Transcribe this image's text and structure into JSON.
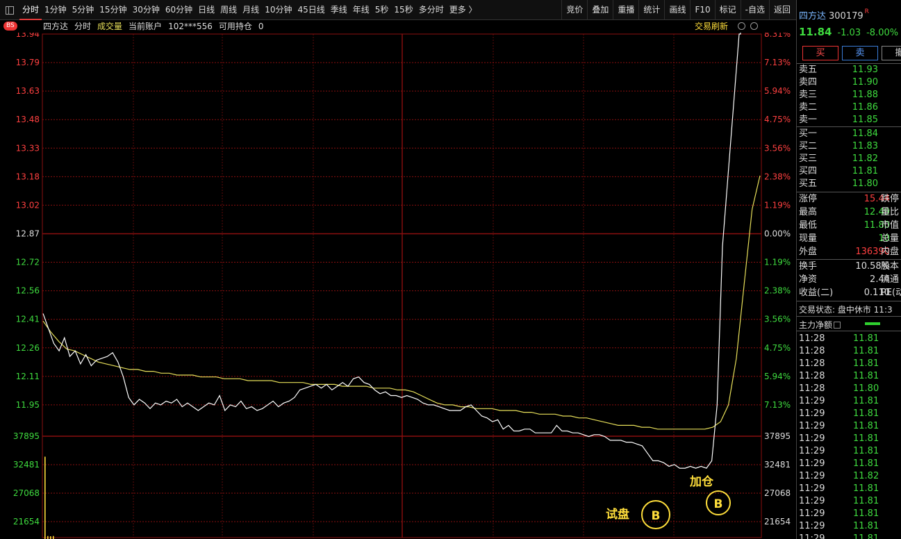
{
  "toolbar": {
    "period_tabs": [
      "分时",
      "1分钟",
      "5分钟",
      "15分钟",
      "30分钟",
      "60分钟",
      "日线",
      "周线",
      "月线",
      "10分钟",
      "45日线",
      "季线",
      "年线",
      "5秒",
      "15秒",
      "多分时",
      "更多 〉"
    ],
    "active_tab": "分时",
    "right_buttons": [
      "竞价",
      "叠加",
      "重播",
      "统计",
      "画线",
      "F10",
      "标记",
      "-自选",
      "返回"
    ]
  },
  "info_bar": {
    "badge": "BS",
    "stock_name": "四方达",
    "mode": "分时",
    "volume_label": "成交量",
    "account_label": "当前账户",
    "account_no": "102***556",
    "position_label": "可用持仓",
    "position_value": "0",
    "refresh_label": "交易刷新"
  },
  "colors": {
    "price_line": "#ffffff",
    "avg_line": "#e8e05a",
    "grid_red": "#8b0f0f",
    "up_red": "#ff4040",
    "down_green": "#3fdc3f",
    "marker_yellow": "#ffde3b"
  },
  "chart_data": {
    "type": "line",
    "y_ticks_left": [
      "13.94",
      "13.79",
      "13.63",
      "13.48",
      "13.33",
      "13.18",
      "13.02",
      "12.87",
      "12.72",
      "12.56",
      "12.41",
      "12.26",
      "12.11",
      "11.95"
    ],
    "y_ticks_right": [
      "8.31%",
      "7.13%",
      "5.94%",
      "4.75%",
      "3.56%",
      "2.38%",
      "1.19%",
      "0.00%",
      "1.19%",
      "2.38%",
      "3.56%",
      "4.75%",
      "5.94%",
      "7.13%"
    ],
    "volume_ticks_left": [
      "37895",
      "32481",
      "27068",
      "21654"
    ],
    "volume_ticks_right": [
      "37895",
      "32481",
      "27068",
      "21654"
    ],
    "ylim": [
      11.95,
      13.94
    ],
    "prev_close": 12.87,
    "series": [
      {
        "values": [
          12.44,
          12.36,
          12.28,
          12.24,
          12.31,
          12.21,
          12.24,
          12.17,
          12.22,
          12.16,
          12.19,
          12.2,
          12.21,
          12.23,
          12.18,
          12.1,
          11.99,
          11.95,
          11.98,
          11.96,
          11.93,
          11.96,
          11.95,
          11.97,
          11.96,
          11.98,
          11.94,
          11.96,
          11.94,
          11.92,
          11.94,
          11.96,
          11.95,
          12.0,
          11.92,
          11.95,
          11.94,
          11.97,
          11.93,
          11.94,
          11.92,
          11.93,
          11.95,
          11.97,
          11.94,
          11.96,
          11.97,
          11.99,
          12.03,
          12.04,
          12.05,
          12.06,
          12.04,
          12.06,
          12.03,
          12.05,
          12.07,
          12.05,
          12.09,
          12.1,
          12.07,
          12.06,
          12.03,
          12.01,
          12.02,
          12.0,
          12.0,
          11.99,
          12.0,
          11.99,
          11.98,
          11.96,
          11.95,
          11.95,
          11.94,
          11.93,
          11.92,
          11.92,
          11.92,
          11.94,
          11.95,
          11.92,
          11.89,
          11.88,
          11.86,
          11.87,
          11.82,
          11.84,
          11.81,
          11.81,
          11.82,
          11.82,
          11.8,
          11.8,
          11.8,
          11.8,
          11.84,
          11.81,
          11.81,
          11.8,
          11.8,
          11.79,
          11.78,
          11.79,
          11.79,
          11.78,
          11.76,
          11.76,
          11.76,
          11.75,
          11.75,
          11.74,
          11.73,
          11.69,
          11.65,
          11.65,
          11.64,
          11.62,
          11.63,
          11.61,
          11.61,
          11.62,
          11.61,
          11.62,
          11.61,
          11.65,
          11.95,
          12.8,
          13.94,
          13.94
        ]
      },
      {
        "values": [
          12.4,
          12.34,
          12.29,
          12.25,
          12.24,
          12.22,
          12.2,
          12.18,
          12.17,
          12.16,
          12.15,
          12.14,
          12.14,
          12.13,
          12.13,
          12.12,
          12.12,
          12.11,
          12.11,
          12.11,
          12.1,
          12.1,
          12.1,
          12.09,
          12.09,
          12.09,
          12.08,
          12.08,
          12.08,
          12.08,
          12.07,
          12.07,
          12.07,
          12.07,
          12.06,
          12.06,
          12.06,
          12.06,
          12.05,
          12.05,
          12.05,
          12.05,
          12.04,
          12.04,
          12.04,
          12.03,
          12.03,
          12.02,
          12.0,
          11.98,
          11.96,
          11.95,
          11.95,
          11.94,
          11.94,
          11.93,
          11.93,
          11.93,
          11.92,
          11.92,
          11.92,
          11.91,
          11.91,
          11.9,
          11.9,
          11.9,
          11.89,
          11.89,
          11.88,
          11.88,
          11.87,
          11.86,
          11.85,
          11.84,
          11.84,
          11.84,
          11.83,
          11.83,
          11.82,
          11.82,
          11.82,
          11.82,
          11.82,
          11.82,
          11.82,
          11.83,
          11.86,
          11.95,
          12.2,
          12.6,
          13.0,
          13.18
        ]
      }
    ],
    "volume_bars": [
      34000,
      2000,
      1500,
      2000
    ]
  },
  "annotations": {
    "buy1_label": "试盘",
    "buy1_marker": "B",
    "buy2_label": "加仓",
    "buy2_marker": "B"
  },
  "panel": {
    "name": "四方达",
    "code": "300179",
    "badge": "R",
    "price": "11.84",
    "change": "-1.03",
    "change_pct": "-8.00%",
    "buy_button": "买",
    "sell_button": "卖",
    "cancel_button": "撤",
    "asks": [
      {
        "label": "卖五",
        "price": "11.93"
      },
      {
        "label": "卖四",
        "price": "11.90"
      },
      {
        "label": "卖三",
        "price": "11.88"
      },
      {
        "label": "卖二",
        "price": "11.86"
      },
      {
        "label": "卖一",
        "price": "11.85"
      }
    ],
    "bids": [
      {
        "label": "买一",
        "price": "11.84"
      },
      {
        "label": "买二",
        "price": "11.83"
      },
      {
        "label": "买三",
        "price": "11.82"
      },
      {
        "label": "买四",
        "price": "11.81"
      },
      {
        "label": "买五",
        "price": "11.80"
      }
    ],
    "stats1": [
      {
        "label": "涨停",
        "value": "15.44",
        "label2": "跌停",
        "color": "#ff4040"
      },
      {
        "label": "最高",
        "value": "12.49",
        "label2": "量比",
        "color": "#3fdc3f"
      },
      {
        "label": "最低",
        "value": "11.80",
        "label2": "市值",
        "color": "#3fdc3f"
      },
      {
        "label": "现量",
        "value": "10",
        "label2": "总量",
        "color": "#3fdc3f"
      },
      {
        "label": "外盘",
        "value": "136390",
        "label2": "内盘",
        "color": "#ff4040"
      }
    ],
    "stats2": [
      {
        "label": "换手",
        "value": "10.58%",
        "label2": "股本",
        "color": "#dddddd"
      },
      {
        "label": "净资",
        "value": "2.44",
        "label2": "流通",
        "color": "#dddddd"
      },
      {
        "label": "收益(二)",
        "value": "0.110",
        "label2": "PE(动",
        "color": "#dddddd"
      }
    ],
    "trade_status": "交易状态: 盘中休市 11:3",
    "main_flow_label": "主力净额",
    "ticks": [
      {
        "time": "11:28",
        "price": "11.81"
      },
      {
        "time": "11:28",
        "price": "11.81"
      },
      {
        "time": "11:28",
        "price": "11.81"
      },
      {
        "time": "11:28",
        "price": "11.81"
      },
      {
        "time": "11:28",
        "price": "11.80"
      },
      {
        "time": "11:29",
        "price": "11.81"
      },
      {
        "time": "11:29",
        "price": "11.81"
      },
      {
        "time": "11:29",
        "price": "11.81"
      },
      {
        "time": "11:29",
        "price": "11.81"
      },
      {
        "time": "11:29",
        "price": "11.81"
      },
      {
        "time": "11:29",
        "price": "11.81"
      },
      {
        "time": "11:29",
        "price": "11.82"
      },
      {
        "time": "11:29",
        "price": "11.81"
      },
      {
        "time": "11:29",
        "price": "11.81"
      },
      {
        "time": "11:29",
        "price": "11.81"
      },
      {
        "time": "11:29",
        "price": "11.81"
      },
      {
        "time": "11:29",
        "price": "11.81"
      }
    ]
  }
}
